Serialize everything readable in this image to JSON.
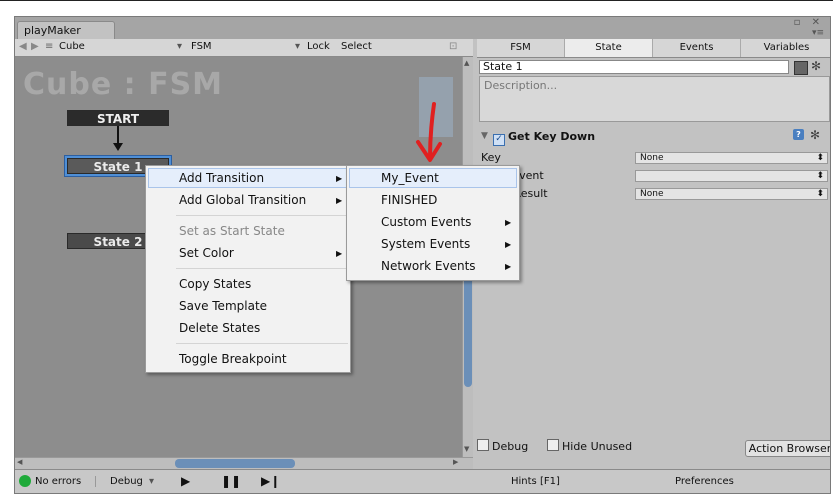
{
  "window": {
    "tab_title": "playMaker"
  },
  "toolbar": {
    "target": "Cube",
    "fsm": "FSM",
    "lock": "Lock",
    "select": "Select"
  },
  "canvas": {
    "title": "Cube : FSM",
    "nodes": {
      "start": "START",
      "state1": "State 1",
      "state2": "State 2"
    }
  },
  "inspector": {
    "tabs": [
      "FSM",
      "State",
      "Events",
      "Variables"
    ],
    "state_name": "State 1",
    "description_placeholder": "Description...",
    "action_title": "Get Key Down",
    "rows": [
      {
        "label": "Key",
        "value": "None"
      },
      {
        "label": "Send Event",
        "value": ""
      },
      {
        "label": "Store Result",
        "value": "None"
      }
    ],
    "debug_label": "Debug",
    "hide_unused_label": "Hide Unused",
    "action_browser": "Action Browser",
    "hints": "Hints [F1]",
    "preferences": "Preferences"
  },
  "status": {
    "errors": "No errors",
    "debug": "Debug"
  },
  "context_menu": {
    "items": [
      "Add Transition",
      "Add Global Transition",
      "Set as Start State",
      "Set Color",
      "Copy States",
      "Save Template",
      "Delete States",
      "Toggle Breakpoint"
    ]
  },
  "submenu": {
    "items": [
      "My_Event",
      "FINISHED",
      "Custom Events",
      "System Events",
      "Network Events"
    ]
  },
  "colors": {
    "accent": "#4f8fd6",
    "annotation": "#e02020",
    "status_ok": "#1faa3a"
  }
}
